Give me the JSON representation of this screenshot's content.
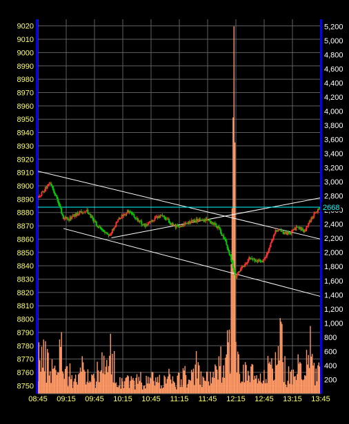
{
  "chart_data": {
    "type": "candlestick",
    "title": "",
    "xlabel": "",
    "ylabel": "",
    "colors": {
      "background": "#000000",
      "grid": "#606060",
      "axis": "#0000ff",
      "price_label": "#ffff66",
      "volume_label": "#ffffff",
      "up_candle": "#ff3030",
      "down_candle": "#00cc00",
      "volume": "#ff9966",
      "trendline": "#ffffff",
      "last_price_line": "#00ffff"
    },
    "x_tick_labels": [
      "08:45",
      "09:15",
      "09:45",
      "10:15",
      "10:45",
      "11:15",
      "11:45",
      "12:15",
      "12:45",
      "13:15",
      "13:45"
    ],
    "price_axis": {
      "side": "left",
      "ylim": [
        8744,
        9025
      ],
      "tick_labels": [
        "9020",
        "9010",
        "9000",
        "8990",
        "8980",
        "8970",
        "8960",
        "8950",
        "8940",
        "8930",
        "8920",
        "8910",
        "8900",
        "8890",
        "8880",
        "8870",
        "8860",
        "8850",
        "8840",
        "8830",
        "8820",
        "8810",
        "8800",
        "8790",
        "8780",
        "8770",
        "8760",
        "8750"
      ],
      "tick_values": [
        9020,
        9010,
        9000,
        8990,
        8980,
        8970,
        8960,
        8950,
        8940,
        8930,
        8920,
        8910,
        8900,
        8890,
        8880,
        8870,
        8860,
        8850,
        8840,
        8830,
        8820,
        8810,
        8800,
        8790,
        8780,
        8770,
        8760,
        8750
      ]
    },
    "volume_axis": {
      "side": "right",
      "ylim": [
        0,
        5300
      ],
      "tick_labels": [
        "5,200",
        "5,000",
        "4,800",
        "4,600",
        "4,400",
        "4,200",
        "4,000",
        "3,800",
        "3,600",
        "3,400",
        "3,200",
        "3,000",
        "2,800",
        "2,600",
        "2,400",
        "2,200",
        "2,000",
        "1,800",
        "1,600",
        "1,400",
        "1,200",
        "1,000",
        "800",
        "600",
        "400",
        "200"
      ],
      "tick_values": [
        5200,
        5000,
        4800,
        4600,
        4400,
        4200,
        4000,
        3800,
        3600,
        3400,
        3200,
        3000,
        2800,
        2600,
        2400,
        2200,
        2000,
        1800,
        1600,
        1400,
        1200,
        1000,
        800,
        600,
        400,
        200
      ]
    },
    "last_price": {
      "label": "2668",
      "value": 8884
    },
    "grid": true,
    "price_path": [
      [
        "08:45",
        8891
      ],
      [
        "08:52",
        8897
      ],
      [
        "08:58",
        8903
      ],
      [
        "09:02",
        8895
      ],
      [
        "09:08",
        8885
      ],
      [
        "09:12",
        8876
      ],
      [
        "09:18",
        8875
      ],
      [
        "09:24",
        8878
      ],
      [
        "09:30",
        8880
      ],
      [
        "09:36",
        8882
      ],
      [
        "09:42",
        8876
      ],
      [
        "09:48",
        8870
      ],
      [
        "09:54",
        8866
      ],
      [
        "10:00",
        8862
      ],
      [
        "10:05",
        8868
      ],
      [
        "10:10",
        8874
      ],
      [
        "10:15",
        8878
      ],
      [
        "10:21",
        8881
      ],
      [
        "10:27",
        8877
      ],
      [
        "10:33",
        8873
      ],
      [
        "10:39",
        8870
      ],
      [
        "10:45",
        8873
      ],
      [
        "10:51",
        8876
      ],
      [
        "10:57",
        8878
      ],
      [
        "11:03",
        8874
      ],
      [
        "11:09",
        8870
      ],
      [
        "11:15",
        8869
      ],
      [
        "11:21",
        8871
      ],
      [
        "11:27",
        8873
      ],
      [
        "11:33",
        8874
      ],
      [
        "11:39",
        8875
      ],
      [
        "11:45",
        8874
      ],
      [
        "11:51",
        8872
      ],
      [
        "11:57",
        8868
      ],
      [
        "12:02",
        8861
      ],
      [
        "12:06",
        8854
      ],
      [
        "12:10",
        8845
      ],
      [
        "12:13",
        8835
      ],
      [
        "12:15",
        8832
      ],
      [
        "12:19",
        8836
      ],
      [
        "12:24",
        8841
      ],
      [
        "12:30",
        8846
      ],
      [
        "12:36",
        8844
      ],
      [
        "12:42",
        8843
      ],
      [
        "12:45",
        8845
      ],
      [
        "12:51",
        8854
      ],
      [
        "12:57",
        8866
      ],
      [
        "13:03",
        8866
      ],
      [
        "13:09",
        8864
      ],
      [
        "13:15",
        8866
      ],
      [
        "13:21",
        8869
      ],
      [
        "13:27",
        8866
      ],
      [
        "13:33",
        8873
      ],
      [
        "13:39",
        8880
      ],
      [
        "13:45",
        8884
      ]
    ],
    "volume_profile": [
      [
        "08:45",
        700
      ],
      [
        "08:51",
        620
      ],
      [
        "08:57",
        520
      ],
      [
        "09:03",
        450
      ],
      [
        "09:09",
        780
      ],
      [
        "09:15",
        430
      ],
      [
        "09:21",
        300
      ],
      [
        "09:27",
        260
      ],
      [
        "09:33",
        460
      ],
      [
        "09:39",
        310
      ],
      [
        "09:45",
        240
      ],
      [
        "09:51",
        650
      ],
      [
        "09:57",
        330
      ],
      [
        "10:03",
        780
      ],
      [
        "10:09",
        230
      ],
      [
        "10:15",
        240
      ],
      [
        "10:21",
        270
      ],
      [
        "10:27",
        200
      ],
      [
        "10:33",
        260
      ],
      [
        "10:39",
        180
      ],
      [
        "10:45",
        300
      ],
      [
        "10:51",
        240
      ],
      [
        "10:57",
        200
      ],
      [
        "11:03",
        350
      ],
      [
        "11:09",
        180
      ],
      [
        "11:15",
        240
      ],
      [
        "11:21",
        380
      ],
      [
        "11:27",
        230
      ],
      [
        "11:33",
        480
      ],
      [
        "11:39",
        200
      ],
      [
        "11:45",
        310
      ],
      [
        "11:51",
        280
      ],
      [
        "11:57",
        420
      ],
      [
        "12:03",
        760
      ],
      [
        "12:09",
        1050
      ],
      [
        "12:13",
        5200
      ],
      [
        "12:15",
        680
      ],
      [
        "12:21",
        420
      ],
      [
        "12:27",
        320
      ],
      [
        "12:33",
        350
      ],
      [
        "12:39",
        230
      ],
      [
        "12:45",
        260
      ],
      [
        "12:51",
        500
      ],
      [
        "12:57",
        730
      ],
      [
        "13:03",
        860
      ],
      [
        "13:09",
        330
      ],
      [
        "13:15",
        250
      ],
      [
        "13:21",
        450
      ],
      [
        "13:27",
        260
      ],
      [
        "13:33",
        820
      ],
      [
        "13:39",
        340
      ],
      [
        "13:45",
        520
      ]
    ],
    "trendlines": [
      {
        "from": [
          "08:45",
          8911
        ],
        "to": [
          "13:45",
          8860
        ]
      },
      {
        "from": [
          "09:12",
          8868
        ],
        "to": [
          "13:45",
          8817
        ]
      },
      {
        "from": [
          "10:03",
          8861
        ],
        "to": [
          "13:45",
          8891
        ]
      }
    ]
  }
}
